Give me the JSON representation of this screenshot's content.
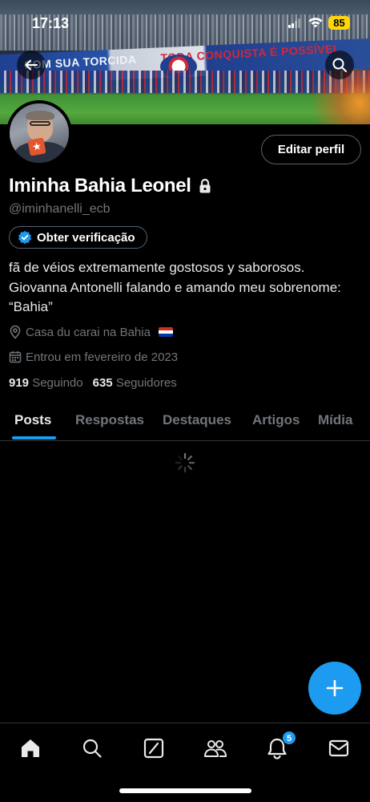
{
  "status_bar": {
    "time": "17:13",
    "battery": "85"
  },
  "banner": {
    "flag_text_left": "COM SUA TORCIDA",
    "flag_text_right": "TODA CONQUISTA É POSSÍVEL"
  },
  "header_actions": {
    "back_icon": "arrow-left-icon",
    "search_icon": "search-icon"
  },
  "profile": {
    "edit_button_label": "Editar perfil",
    "display_name": "Iminha Bahia Leonel",
    "handle": "@iminhanelli_ecb",
    "verify_button_label": "Obter verificação",
    "bio_line1": "fã de véios extremamente gostosos y saborosos.",
    "bio_line2": "Giovanna Antonelli falando e amando meu sobrenome:",
    "bio_line3": "“Bahia”",
    "location": "Casa du carai na Bahia",
    "joined": "Entrou em fevereiro de 2023",
    "following_count": "919",
    "following_label": "Seguindo",
    "followers_count": "635",
    "followers_label": "Seguidores"
  },
  "tabs": [
    {
      "label": "Posts",
      "active": true
    },
    {
      "label": "Respostas",
      "active": false
    },
    {
      "label": "Destaques",
      "active": false
    },
    {
      "label": "Artigos",
      "active": false
    },
    {
      "label": "Mídia",
      "active": false
    }
  ],
  "bottom_nav": {
    "items": [
      "home-icon",
      "search-icon",
      "grok-icon",
      "communities-icon",
      "notifications-icon",
      "messages-icon"
    ],
    "notifications_badge": "5"
  },
  "colors": {
    "accent": "#1d9bf0",
    "muted": "#71767b",
    "background": "#000000"
  }
}
